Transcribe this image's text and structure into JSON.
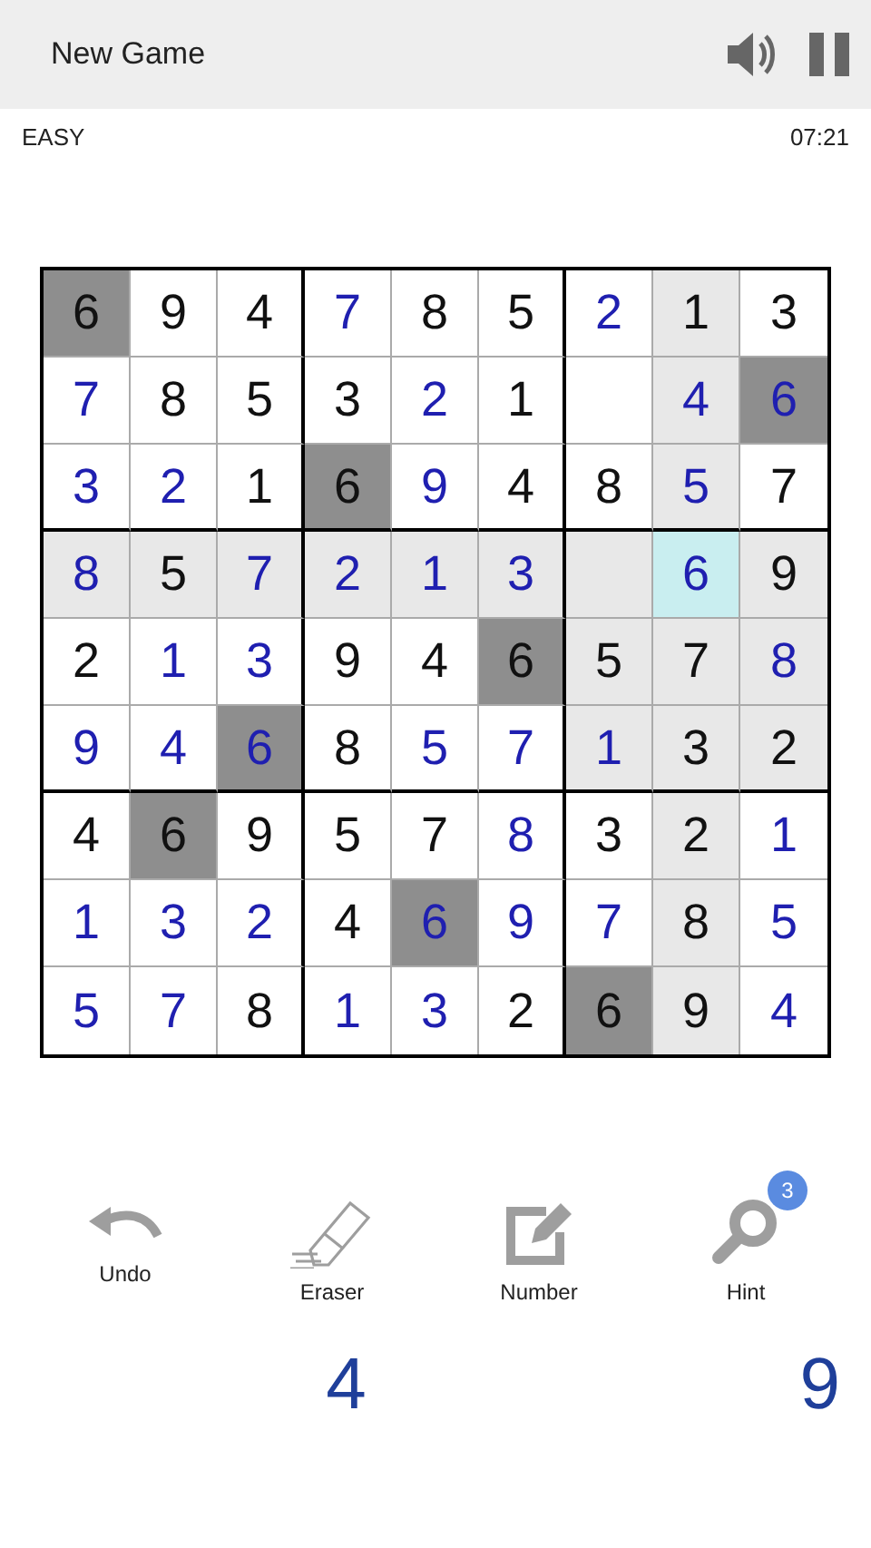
{
  "app_bar": {
    "title": "New Game",
    "sound_on": true
  },
  "status": {
    "difficulty": "EASY",
    "timer": "07:21"
  },
  "grid": [
    [
      {
        "value": "6",
        "given": true,
        "highlighted": false,
        "matching": true,
        "selected": false
      },
      {
        "value": "9",
        "given": true,
        "highlighted": false,
        "matching": false,
        "selected": false
      },
      {
        "value": "4",
        "given": true,
        "highlighted": false,
        "matching": false,
        "selected": false
      },
      {
        "value": "7",
        "given": false,
        "highlighted": false,
        "matching": false,
        "selected": false
      },
      {
        "value": "8",
        "given": true,
        "highlighted": false,
        "matching": false,
        "selected": false
      },
      {
        "value": "5",
        "given": true,
        "highlighted": false,
        "matching": false,
        "selected": false
      },
      {
        "value": "2",
        "given": false,
        "highlighted": false,
        "matching": false,
        "selected": false
      },
      {
        "value": "1",
        "given": true,
        "highlighted": true,
        "matching": false,
        "selected": false
      },
      {
        "value": "3",
        "given": true,
        "highlighted": false,
        "matching": false,
        "selected": false
      }
    ],
    [
      {
        "value": "7",
        "given": false,
        "highlighted": false,
        "matching": false,
        "selected": false
      },
      {
        "value": "8",
        "given": true,
        "highlighted": false,
        "matching": false,
        "selected": false
      },
      {
        "value": "5",
        "given": true,
        "highlighted": false,
        "matching": false,
        "selected": false
      },
      {
        "value": "3",
        "given": true,
        "highlighted": false,
        "matching": false,
        "selected": false
      },
      {
        "value": "2",
        "given": false,
        "highlighted": false,
        "matching": false,
        "selected": false
      },
      {
        "value": "1",
        "given": true,
        "highlighted": false,
        "matching": false,
        "selected": false
      },
      {
        "highlighted": false,
        "matching": false,
        "selected": false
      },
      {
        "value": "4",
        "given": false,
        "highlighted": true,
        "matching": false,
        "selected": false
      },
      {
        "value": "6",
        "given": false,
        "highlighted": false,
        "matching": true,
        "selected": false
      }
    ],
    [
      {
        "value": "3",
        "given": false,
        "highlighted": false,
        "matching": false,
        "selected": false
      },
      {
        "value": "2",
        "given": false,
        "highlighted": false,
        "matching": false,
        "selected": false
      },
      {
        "value": "1",
        "given": true,
        "highlighted": false,
        "matching": false,
        "selected": false
      },
      {
        "value": "6",
        "given": true,
        "highlighted": false,
        "matching": true,
        "selected": false
      },
      {
        "value": "9",
        "given": false,
        "highlighted": false,
        "matching": false,
        "selected": false
      },
      {
        "value": "4",
        "given": true,
        "highlighted": false,
        "matching": false,
        "selected": false
      },
      {
        "value": "8",
        "given": true,
        "highlighted": false,
        "matching": false,
        "selected": false
      },
      {
        "value": "5",
        "given": false,
        "highlighted": true,
        "matching": false,
        "selected": false
      },
      {
        "value": "7",
        "given": true,
        "highlighted": false,
        "matching": false,
        "selected": false
      }
    ],
    [
      {
        "value": "8",
        "given": false,
        "highlighted": true,
        "matching": false,
        "selected": false
      },
      {
        "value": "5",
        "given": true,
        "highlighted": true,
        "matching": false,
        "selected": false
      },
      {
        "value": "7",
        "given": false,
        "highlighted": true,
        "matching": false,
        "selected": false
      },
      {
        "value": "2",
        "given": false,
        "highlighted": true,
        "matching": false,
        "selected": false
      },
      {
        "value": "1",
        "given": false,
        "highlighted": true,
        "matching": false,
        "selected": false
      },
      {
        "value": "3",
        "given": false,
        "highlighted": true,
        "matching": false,
        "selected": false
      },
      {
        "highlighted": true,
        "matching": false,
        "selected": false
      },
      {
        "value": "6",
        "given": false,
        "highlighted": true,
        "matching": false,
        "selected": true
      },
      {
        "value": "9",
        "given": true,
        "highlighted": true,
        "matching": false,
        "selected": false
      }
    ],
    [
      {
        "value": "2",
        "given": true,
        "highlighted": false,
        "matching": false,
        "selected": false
      },
      {
        "value": "1",
        "given": false,
        "highlighted": false,
        "matching": false,
        "selected": false
      },
      {
        "value": "3",
        "given": false,
        "highlighted": false,
        "matching": false,
        "selected": false
      },
      {
        "value": "9",
        "given": true,
        "highlighted": false,
        "matching": false,
        "selected": false
      },
      {
        "value": "4",
        "given": true,
        "highlighted": false,
        "matching": false,
        "selected": false
      },
      {
        "value": "6",
        "given": true,
        "highlighted": false,
        "matching": true,
        "selected": false
      },
      {
        "value": "5",
        "given": true,
        "highlighted": true,
        "matching": false,
        "selected": false
      },
      {
        "value": "7",
        "given": true,
        "highlighted": true,
        "matching": false,
        "selected": false
      },
      {
        "value": "8",
        "given": false,
        "highlighted": true,
        "matching": false,
        "selected": false
      }
    ],
    [
      {
        "value": "9",
        "given": false,
        "highlighted": false,
        "matching": false,
        "selected": false
      },
      {
        "value": "4",
        "given": false,
        "highlighted": false,
        "matching": false,
        "selected": false
      },
      {
        "value": "6",
        "given": false,
        "highlighted": false,
        "matching": true,
        "selected": false
      },
      {
        "value": "8",
        "given": true,
        "highlighted": false,
        "matching": false,
        "selected": false
      },
      {
        "value": "5",
        "given": false,
        "highlighted": false,
        "matching": false,
        "selected": false
      },
      {
        "value": "7",
        "given": false,
        "highlighted": false,
        "matching": false,
        "selected": false
      },
      {
        "value": "1",
        "given": false,
        "highlighted": true,
        "matching": false,
        "selected": false
      },
      {
        "value": "3",
        "given": true,
        "highlighted": true,
        "matching": false,
        "selected": false
      },
      {
        "value": "2",
        "given": true,
        "highlighted": true,
        "matching": false,
        "selected": false
      }
    ],
    [
      {
        "value": "4",
        "given": true,
        "highlighted": false,
        "matching": false,
        "selected": false
      },
      {
        "value": "6",
        "given": true,
        "highlighted": false,
        "matching": true,
        "selected": false
      },
      {
        "value": "9",
        "given": true,
        "highlighted": false,
        "matching": false,
        "selected": false
      },
      {
        "value": "5",
        "given": true,
        "highlighted": false,
        "matching": false,
        "selected": false
      },
      {
        "value": "7",
        "given": true,
        "highlighted": false,
        "matching": false,
        "selected": false
      },
      {
        "value": "8",
        "given": false,
        "highlighted": false,
        "matching": false,
        "selected": false
      },
      {
        "value": "3",
        "given": true,
        "highlighted": false,
        "matching": false,
        "selected": false
      },
      {
        "value": "2",
        "given": true,
        "highlighted": true,
        "matching": false,
        "selected": false
      },
      {
        "value": "1",
        "given": false,
        "highlighted": false,
        "matching": false,
        "selected": false
      }
    ],
    [
      {
        "value": "1",
        "given": false,
        "highlighted": false,
        "matching": false,
        "selected": false
      },
      {
        "value": "3",
        "given": false,
        "highlighted": false,
        "matching": false,
        "selected": false
      },
      {
        "value": "2",
        "given": false,
        "highlighted": false,
        "matching": false,
        "selected": false
      },
      {
        "value": "4",
        "given": true,
        "highlighted": false,
        "matching": false,
        "selected": false
      },
      {
        "value": "6",
        "given": false,
        "highlighted": false,
        "matching": true,
        "selected": false
      },
      {
        "value": "9",
        "given": false,
        "highlighted": false,
        "matching": false,
        "selected": false
      },
      {
        "value": "7",
        "given": false,
        "highlighted": false,
        "matching": false,
        "selected": false
      },
      {
        "value": "8",
        "given": true,
        "highlighted": true,
        "matching": false,
        "selected": false
      },
      {
        "value": "5",
        "given": false,
        "highlighted": false,
        "matching": false,
        "selected": false
      }
    ],
    [
      {
        "value": "5",
        "given": false,
        "highlighted": false,
        "matching": false,
        "selected": false
      },
      {
        "value": "7",
        "given": false,
        "highlighted": false,
        "matching": false,
        "selected": false
      },
      {
        "value": "8",
        "given": true,
        "highlighted": false,
        "matching": false,
        "selected": false
      },
      {
        "value": "1",
        "given": false,
        "highlighted": false,
        "matching": false,
        "selected": false
      },
      {
        "value": "3",
        "given": false,
        "highlighted": false,
        "matching": false,
        "selected": false
      },
      {
        "value": "2",
        "given": true,
        "highlighted": false,
        "matching": false,
        "selected": false
      },
      {
        "value": "6",
        "given": true,
        "highlighted": false,
        "matching": true,
        "selected": false
      },
      {
        "value": "9",
        "given": true,
        "highlighted": true,
        "matching": false,
        "selected": false
      },
      {
        "value": "4",
        "given": false,
        "highlighted": false,
        "matching": false,
        "selected": false
      }
    ]
  ],
  "tools": [
    {
      "kind": "undo",
      "label": "Undo"
    },
    {
      "kind": "eraser",
      "label": "Eraser"
    },
    {
      "kind": "number",
      "label": "Number"
    },
    {
      "kind": "hint",
      "label": "Hint",
      "badge": "3"
    }
  ],
  "number_pad": [
    {
      "digit": "4"
    },
    {
      "digit": "9"
    }
  ]
}
